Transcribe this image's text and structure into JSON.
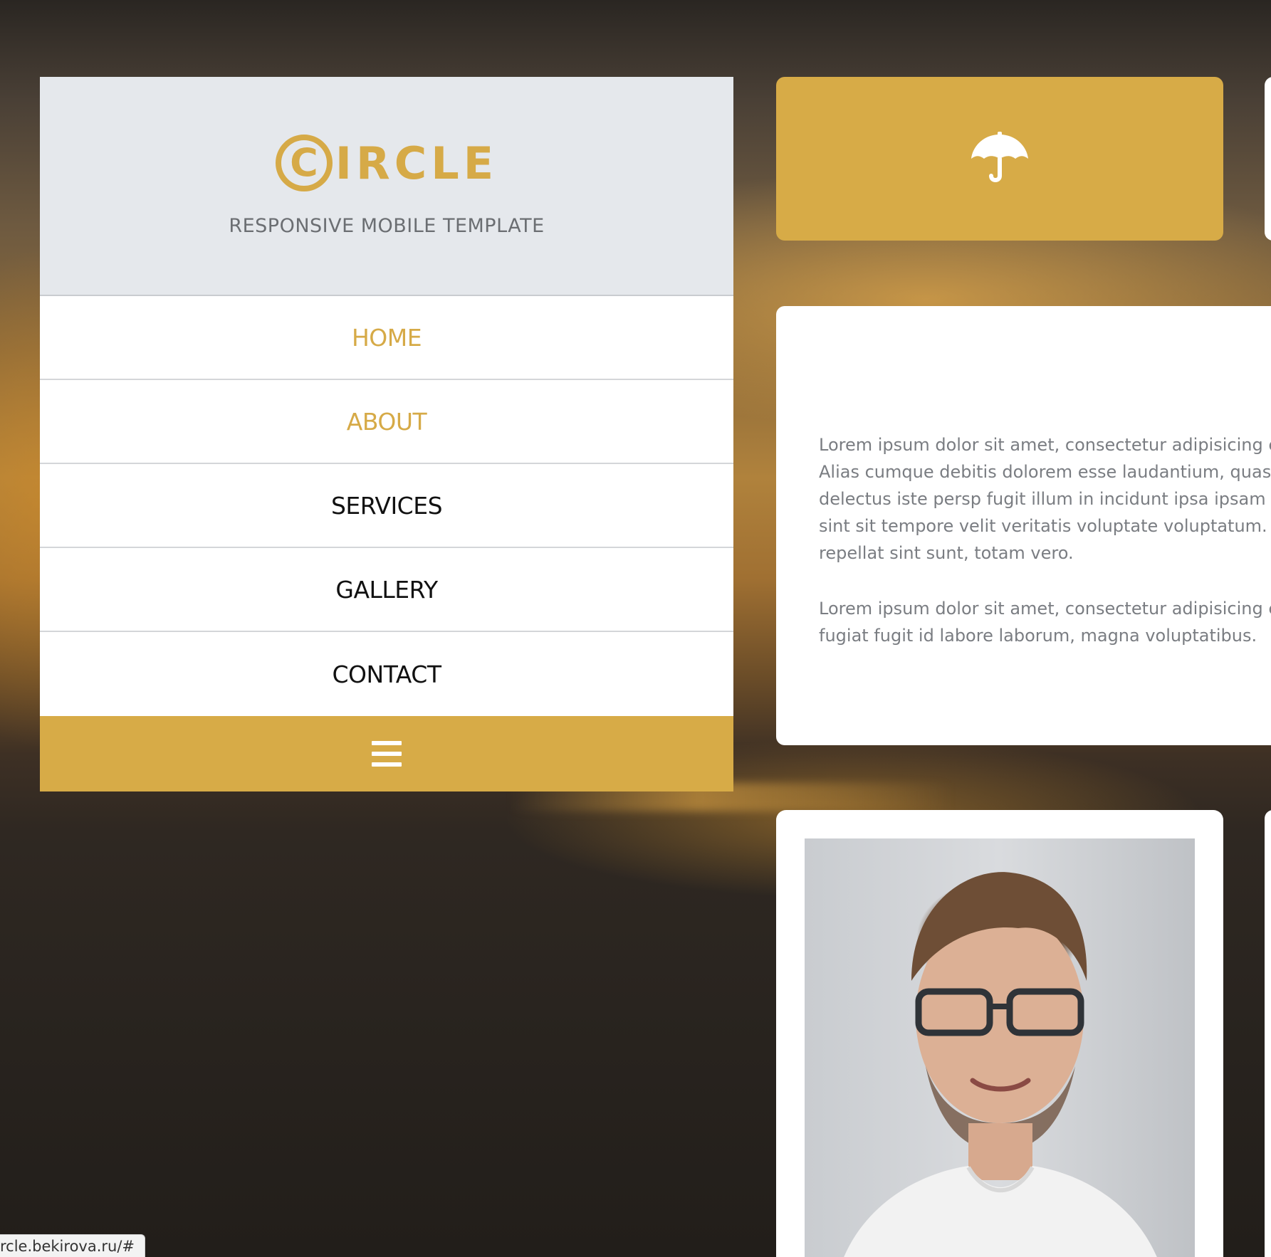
{
  "brand": {
    "logo_letter": "C",
    "logo_text": "IRCLE",
    "tagline": "RESPONSIVE MOBILE TEMPLATE",
    "accent_color": "#d7ab47"
  },
  "nav": {
    "items": [
      {
        "label": "HOME",
        "accent": true
      },
      {
        "label": "ABOUT",
        "accent": true
      },
      {
        "label": "SERVICES",
        "accent": false
      },
      {
        "label": "GALLERY",
        "accent": false
      },
      {
        "label": "CONTACT",
        "accent": false
      }
    ],
    "menu_icon": "hamburger-icon"
  },
  "cards": {
    "feature_icon": "umbrella-icon",
    "about_paragraphs": [
      "Lorem ipsum dolor sit amet, consectetur adipisicing e vero voluptatum. Alias cumque debitis dolorem esse laudantium, quasi? Consequuntur delectus iste persp fugit illum in incidunt ipsa ipsam laboriosam laudant sint sit tempore velit veritatis voluptate voluptatum. A recusandae repellat sint sunt, totam vero.",
      "Lorem ipsum dolor sit amet, consectetur adipisicing e exercitationem fugiat fugit id labore laborum, magna voluptatibus."
    ],
    "profile_photo": "portrait-photo"
  },
  "status_bar": {
    "url": "rcle.bekirova.ru/#"
  }
}
